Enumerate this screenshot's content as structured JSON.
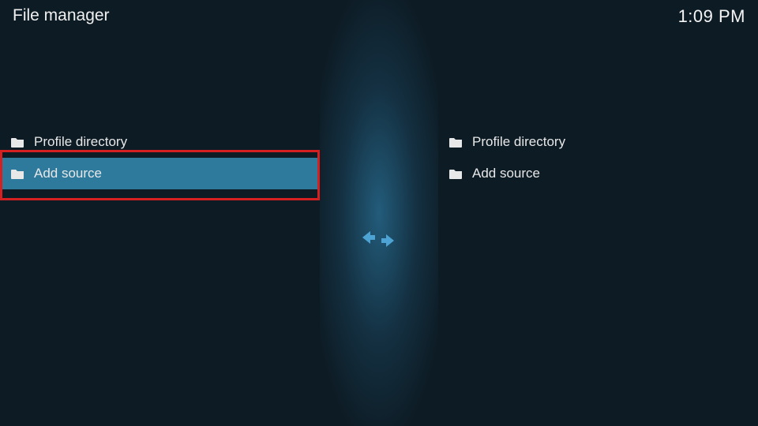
{
  "header": {
    "title": "File manager",
    "time": "1:09 PM"
  },
  "left_pane": {
    "items": [
      {
        "label": "Profile directory",
        "selected": false
      },
      {
        "label": "Add source",
        "selected": true
      }
    ]
  },
  "right_pane": {
    "items": [
      {
        "label": "Profile directory",
        "selected": false
      },
      {
        "label": "Add source",
        "selected": false
      }
    ]
  }
}
